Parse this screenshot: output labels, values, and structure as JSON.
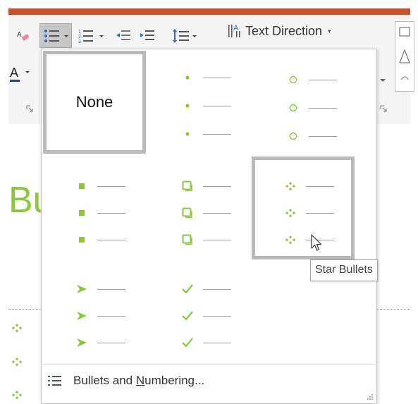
{
  "ribbon": {
    "text_direction_label": "Text Direction",
    "caret": "▾",
    "accent_color": "#c9512a"
  },
  "slide": {
    "title_partial": "Bu",
    "title_color": "#8cc63f"
  },
  "bullet_library": {
    "none_label": "None",
    "bullet_color": "#8cc63f",
    "styles": [
      {
        "id": "none",
        "name": "None",
        "selected": true
      },
      {
        "id": "filled-round",
        "icon": "filled-round-bullet-icon"
      },
      {
        "id": "hollow-round",
        "icon": "hollow-round-bullet-icon"
      },
      {
        "id": "filled-square",
        "icon": "filled-square-bullet-icon"
      },
      {
        "id": "hollow-square",
        "icon": "hollow-square-bullet-icon"
      },
      {
        "id": "star",
        "name": "Star Bullets",
        "icon": "star-bullet-icon",
        "hovered": true
      },
      {
        "id": "arrow",
        "icon": "arrow-bullet-icon"
      },
      {
        "id": "checkmark",
        "icon": "checkmark-bullet-icon"
      }
    ],
    "tooltip": "Star Bullets"
  },
  "menu": {
    "bullets_numbering_pre": "Bullets and ",
    "bullets_numbering_accel": "N",
    "bullets_numbering_post": "umbering..."
  }
}
